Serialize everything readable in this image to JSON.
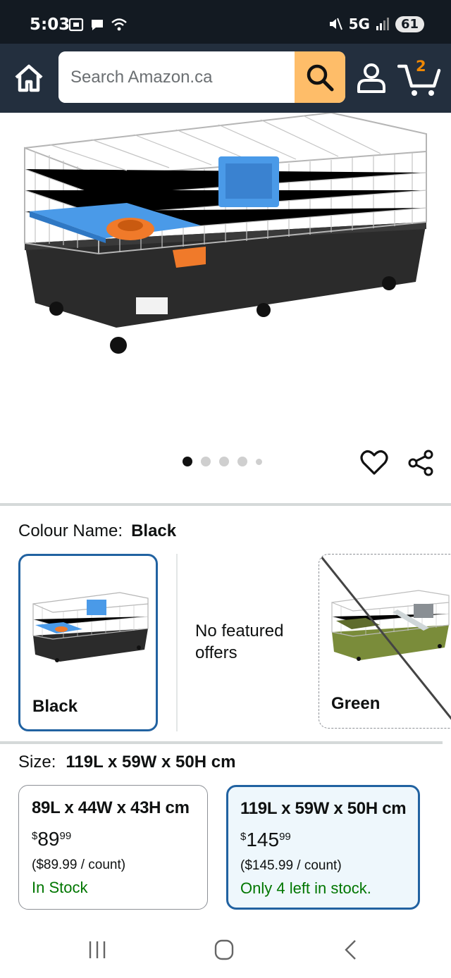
{
  "status_bar": {
    "time": "5:03",
    "network": "5G",
    "battery": "61"
  },
  "header": {
    "search": {
      "placeholder": "Search Amazon.ca"
    },
    "cart_count": "2",
    "colors": {
      "header_bg": "#232f3e",
      "search_button": "#febd69",
      "cart_count": "#f08804"
    }
  },
  "gallery": {
    "image_count": 5,
    "active_index": 0,
    "icons": [
      "heart-icon",
      "share-icon"
    ]
  },
  "colour": {
    "label": "Colour Name:",
    "selected": "Black",
    "options": [
      {
        "name": "Black",
        "state": "selected"
      },
      {
        "note": "No featured offers"
      },
      {
        "name": "Green",
        "state": "unavailable"
      }
    ]
  },
  "size": {
    "label": "Size:",
    "selected": "119L x 59W x 50H cm",
    "options": [
      {
        "title": "89L x 44W x 43H cm",
        "price_symbol": "$",
        "price_whole": "89",
        "price_fraction": "99",
        "unit_price": "($89.99 / count)",
        "stock": "In Stock"
      },
      {
        "title": "119L x 59W x 50H cm",
        "price_symbol": "$",
        "price_whole": "145",
        "price_fraction": "99",
        "unit_price": "($145.99 / count)",
        "stock": "Only 4 left in stock."
      }
    ]
  },
  "nav": {
    "icons": [
      "recent-apps-icon",
      "home-icon",
      "back-icon"
    ]
  }
}
